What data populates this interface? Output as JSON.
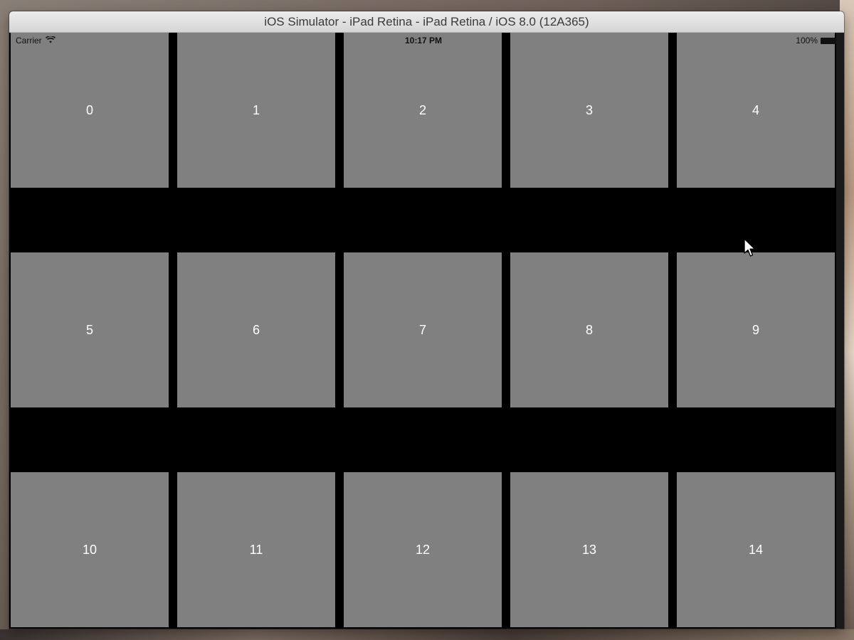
{
  "window": {
    "title": "iOS Simulator - iPad Retina - iPad Retina / iOS 8.0 (12A365)"
  },
  "statusbar": {
    "carrier": "Carrier",
    "wifi_icon": "wifi-icon",
    "time": "10:17 PM",
    "battery_percent": "100%",
    "battery_icon": "battery-icon"
  },
  "grid": {
    "tiles": [
      "0",
      "1",
      "2",
      "3",
      "4",
      "5",
      "6",
      "7",
      "8",
      "9",
      "10",
      "11",
      "12",
      "13",
      "14"
    ],
    "tile_color": "#808080",
    "background_color": "#000000",
    "label_color": "#ffffff"
  }
}
